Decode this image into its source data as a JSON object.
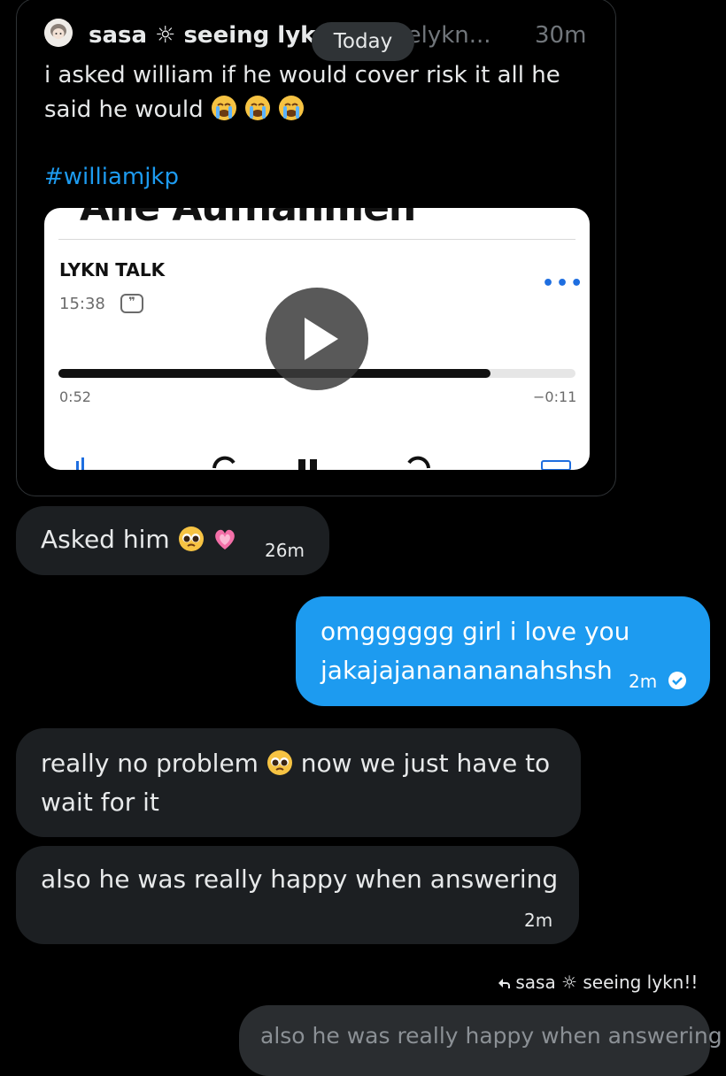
{
  "tweet": {
    "author_name": "sasa ☼ seeing lykn!",
    "author_handle": "@lovelykn...",
    "time": "30m",
    "text_line1": "i asked william if he would cover risk it all he",
    "text_line2": "said he would",
    "hashtag": "#williamjkp"
  },
  "divider_label": "Today",
  "media": {
    "cut_title": "Alle Aufnahmen",
    "show_name": "LYKN TALK",
    "duration": "15:38",
    "elapsed": "0:52",
    "remaining": "−0:11",
    "progress": 0.835
  },
  "messages": [
    {
      "text": "Asked him",
      "time": "26m"
    },
    {
      "line1": "omgggggg girl i love you",
      "line2": "jakajajananananahshsh",
      "time": "2m"
    },
    {
      "line1": "really no problem",
      "line1b": "now we just have to",
      "line2": "wait for it"
    },
    {
      "text": "also he was really happy when answering",
      "time": "2m"
    }
  ],
  "reply": {
    "reference": "sasa ☼ seeing lykn!!",
    "quoted": "also he was really happy when answering"
  },
  "colors": {
    "accent": "#1d9bf0",
    "bubble_in": "#1c1f22",
    "background": "#000000"
  }
}
